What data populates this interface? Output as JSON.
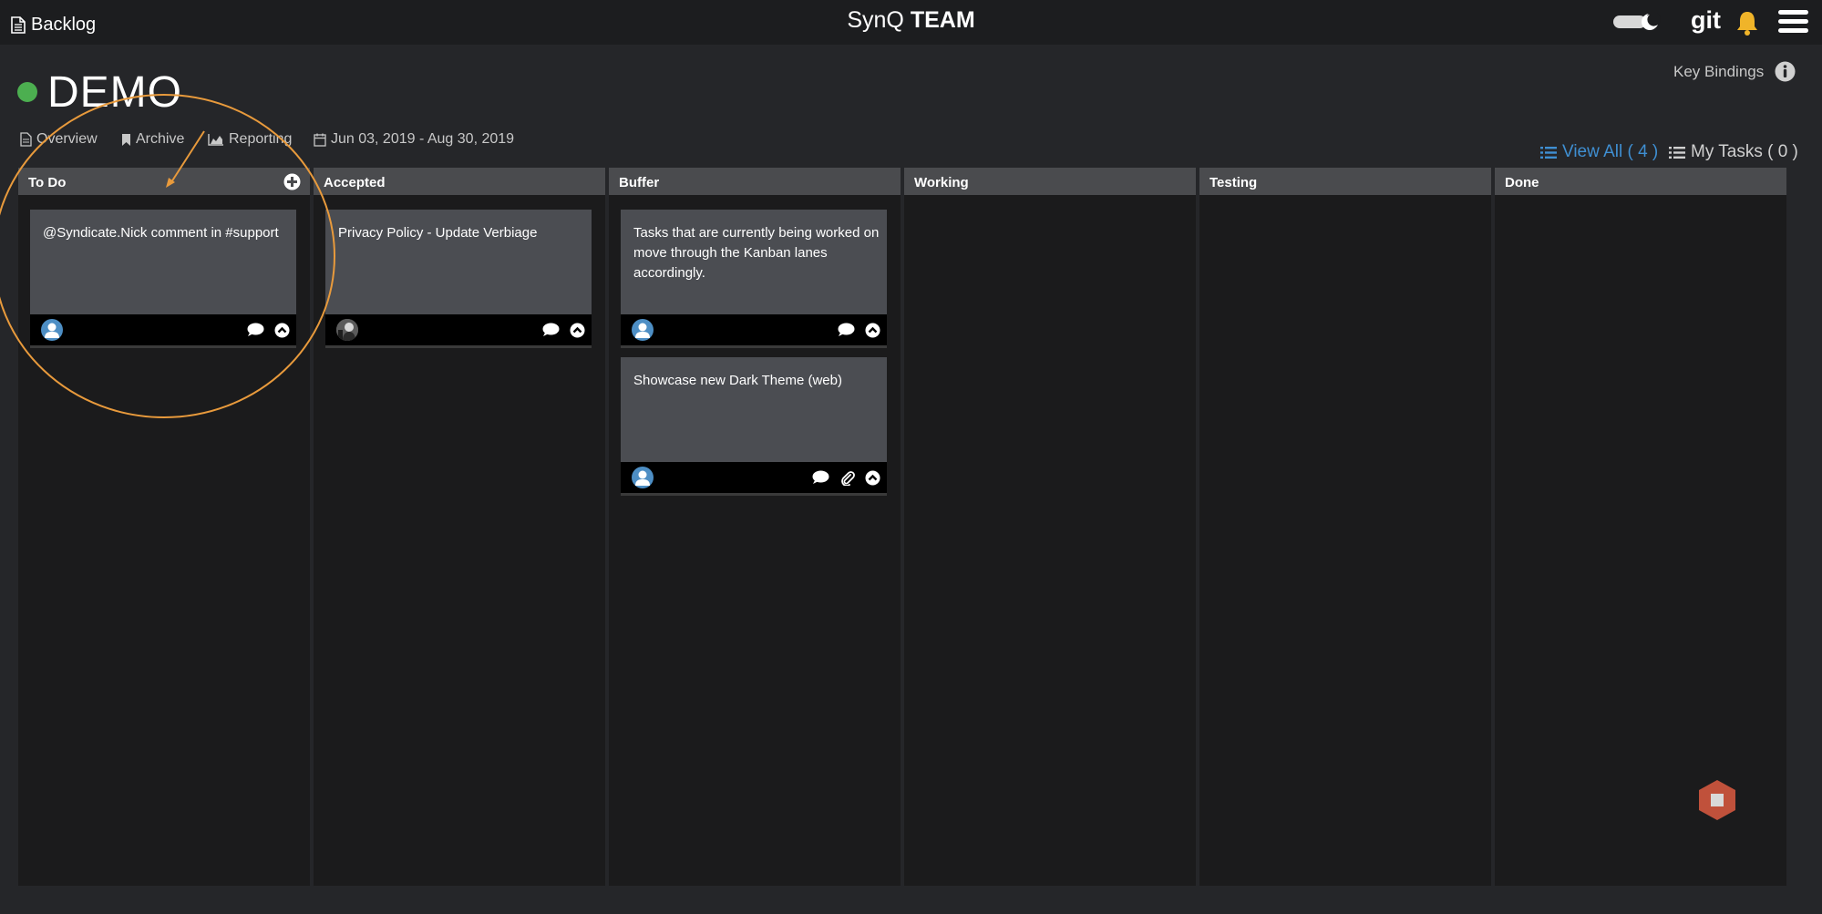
{
  "topbar": {
    "backlog_label": "Backlog",
    "brand_part1": "SynQ",
    "brand_part2": "TEAM",
    "git_label": "git",
    "bell_color": "#f0b429"
  },
  "project": {
    "name": "DEMO",
    "status_color": "#4caf50",
    "key_bindings_label": "Key Bindings"
  },
  "subnav": {
    "overview": "Overview",
    "archive": "Archive",
    "reporting": "Reporting",
    "date_range": "Jun 03, 2019 - Aug 30, 2019"
  },
  "filters": {
    "view_all": "View All ( 4 )",
    "my_tasks": "My Tasks ( 0 )",
    "accent": "#3f8fd2"
  },
  "lanes": [
    {
      "name": "To Do"
    },
    {
      "name": "Accepted"
    },
    {
      "name": "Buffer"
    },
    {
      "name": "Working"
    },
    {
      "name": "Testing"
    },
    {
      "name": "Done"
    }
  ],
  "cards": [
    {
      "lane": "To Do",
      "title": "@Syndicate.Nick comment in #support",
      "avatar": "default-user",
      "icons": [
        "comment-icon",
        "collapse-icon"
      ]
    },
    {
      "lane": "Accepted",
      "title": "Privacy Policy - Update Verbiage",
      "avatar": "photo-user",
      "icons": [
        "comment-icon",
        "collapse-icon"
      ]
    },
    {
      "lane": "Buffer",
      "title": "Tasks that are currently being worked on move through the Kanban lanes accordingly.",
      "avatar": "default-user",
      "icons": [
        "comment-icon",
        "collapse-icon"
      ]
    },
    {
      "lane": "Buffer",
      "title": "Showcase new Dark Theme (web)",
      "avatar": "default-user",
      "icons": [
        "comment-icon",
        "attachment-icon",
        "collapse-icon"
      ]
    }
  ],
  "annotation_color": "#e89a3c",
  "fab_color": "#c0513b"
}
